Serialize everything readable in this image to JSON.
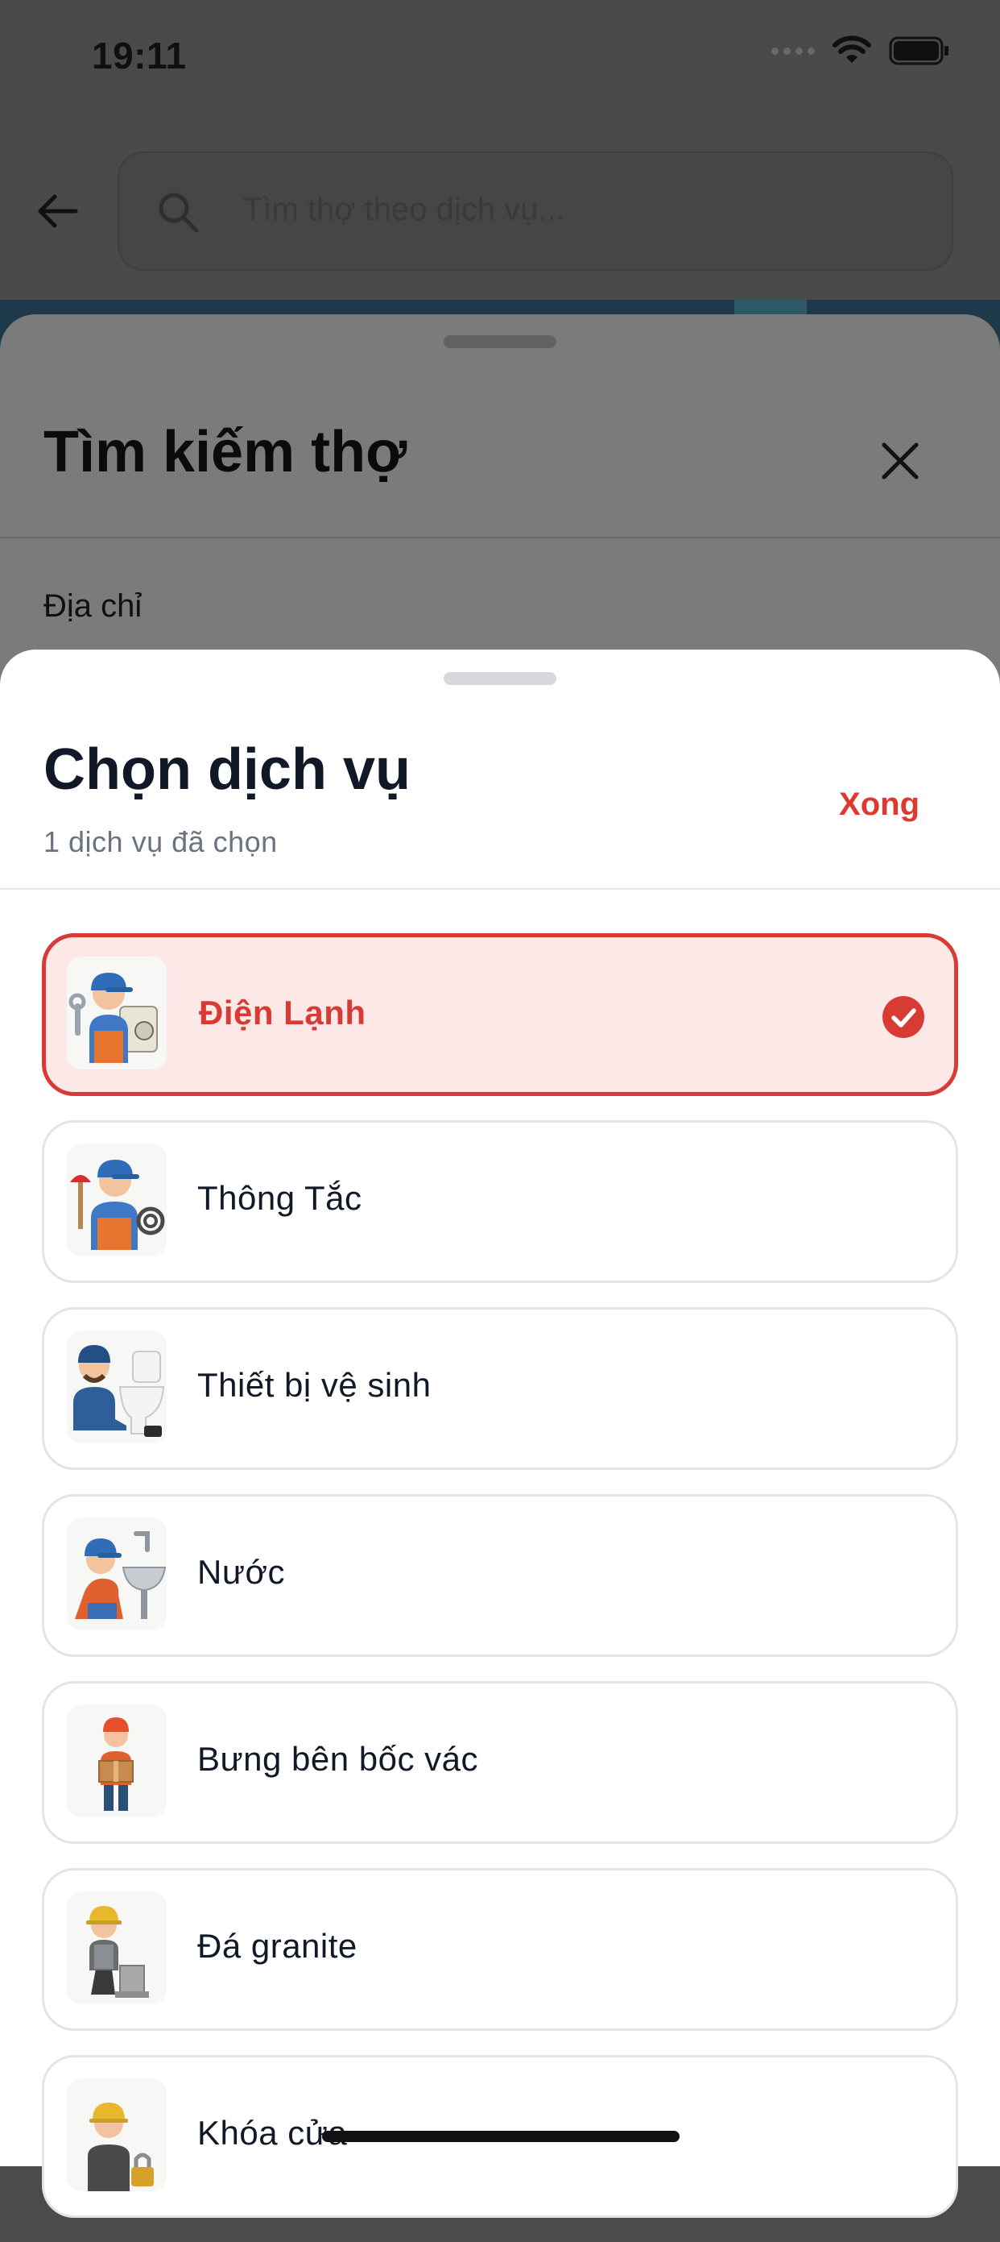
{
  "status_bar": {
    "time": "19:11",
    "icons": [
      "signal-dots-icon",
      "wifi-icon",
      "battery-icon"
    ]
  },
  "background_screen": {
    "search": {
      "placeholder": "Tìm thợ theo dịch vụ..."
    },
    "sheet": {
      "title": "Tìm kiếm thợ",
      "address_label": "Địa chỉ"
    }
  },
  "service_sheet": {
    "title": "Chọn dịch vụ",
    "subtitle": "1 dịch vụ đã chọn",
    "done_label": "Xong",
    "services": [
      {
        "label": "Điện Lạnh",
        "selected": true,
        "icon": "technician-ac-icon"
      },
      {
        "label": "Thông Tắc",
        "selected": false,
        "icon": "plumber-plunger-icon"
      },
      {
        "label": "Thiết bị vệ sinh",
        "selected": false,
        "icon": "toilet-repair-icon"
      },
      {
        "label": "Nước",
        "selected": false,
        "icon": "sink-repair-icon"
      },
      {
        "label": "Bưng bên bốc vác",
        "selected": false,
        "icon": "porter-box-icon"
      },
      {
        "label": "Đá granite",
        "selected": false,
        "icon": "stone-worker-icon"
      },
      {
        "label": "Khóa cửa",
        "selected": false,
        "icon": "locksmith-icon"
      }
    ]
  },
  "colors": {
    "accent": "#d83a34",
    "selected_bg": "#fce8e7",
    "overlay": "#4a4a4a"
  }
}
